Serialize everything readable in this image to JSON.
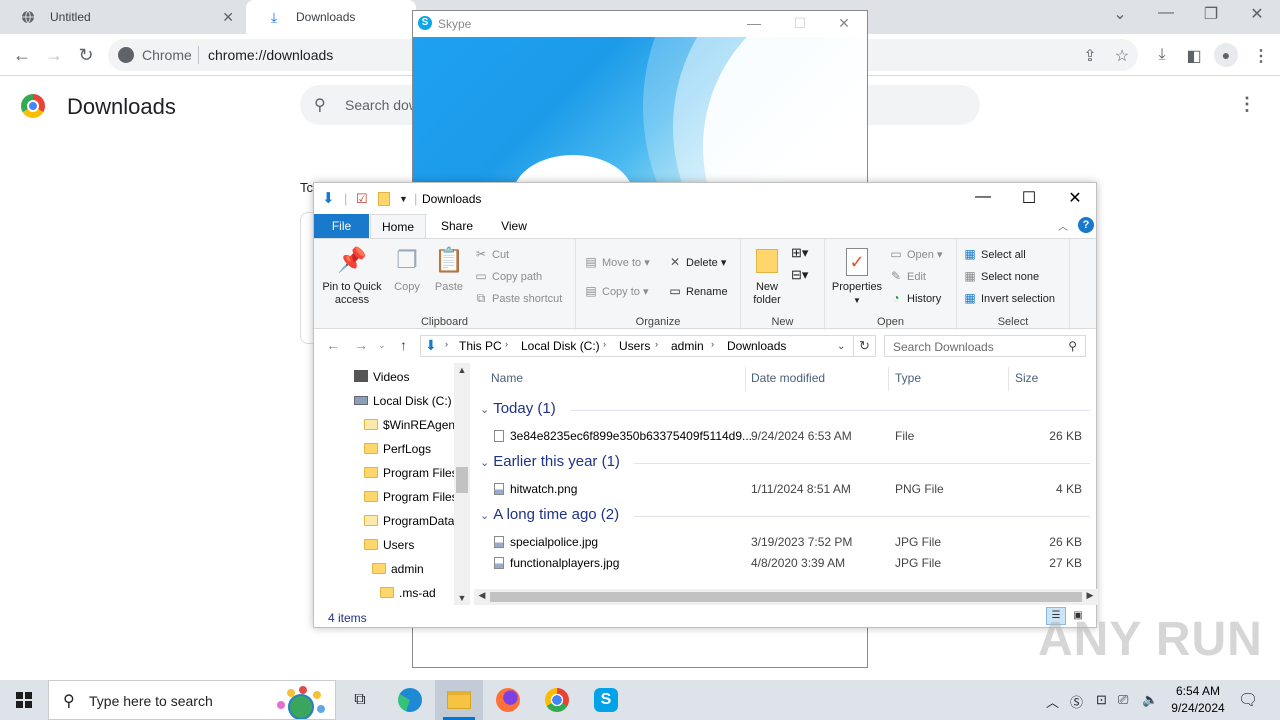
{
  "chrome": {
    "tabs": [
      {
        "title": "Untitled",
        "close": "✕"
      },
      {
        "title": "Downloads",
        "close": "✕"
      }
    ],
    "omnibox": {
      "site_chip": "Chrome",
      "url": "chrome://downloads"
    },
    "page_title": "Downloads",
    "search_placeholder": "Search downloads",
    "partial_label": "Tc"
  },
  "skype": {
    "title": "Skype"
  },
  "explorer": {
    "title": "Downloads",
    "ribbon_tabs": [
      "File",
      "Home",
      "Share",
      "View"
    ],
    "clipboard": {
      "label": "Clipboard",
      "pin": "Pin to Quick access",
      "copy": "Copy",
      "paste": "Paste",
      "cut": "Cut",
      "copy_path": "Copy path",
      "paste_shortcut": "Paste shortcut"
    },
    "organize": {
      "label": "Organize",
      "move_to": "Move to",
      "copy_to": "Copy to",
      "delete": "Delete",
      "rename": "Rename"
    },
    "new": {
      "label": "New",
      "new_folder": "New folder"
    },
    "open": {
      "label": "Open",
      "properties": "Properties",
      "open": "Open",
      "edit": "Edit",
      "history": "History"
    },
    "select": {
      "label": "Select",
      "select_all": "Select all",
      "select_none": "Select none",
      "invert": "Invert selection"
    },
    "breadcrumb": [
      "This PC",
      "Local Disk (C:)",
      "Users",
      "admin",
      "Downloads"
    ],
    "search_placeholder": "Search Downloads",
    "nav_tree": [
      "Videos",
      "Local Disk (C:)",
      "$WinREAgent",
      "PerfLogs",
      "Program Files",
      "Program Files",
      "ProgramData",
      "Users",
      "admin",
      ".ms-ad"
    ],
    "columns": [
      "Name",
      "Date modified",
      "Type",
      "Size"
    ],
    "groups": [
      {
        "label": "Today (1)",
        "files": [
          {
            "name": "3e84e8235ec6f899e350b63375409f5114d9...",
            "date": "9/24/2024 6:53 AM",
            "type": "File",
            "size": "26 KB",
            "icon": "doc-icon"
          }
        ]
      },
      {
        "label": "Earlier this year (1)",
        "files": [
          {
            "name": "hitwatch.png",
            "date": "1/11/2024 8:51 AM",
            "type": "PNG File",
            "size": "4 KB",
            "icon": "image-icon"
          }
        ]
      },
      {
        "label": "A long time ago (2)",
        "files": [
          {
            "name": "specialpolice.jpg",
            "date": "3/19/2023 7:52 PM",
            "type": "JPG File",
            "size": "26 KB",
            "icon": "image-icon"
          },
          {
            "name": "functionalplayers.jpg",
            "date": "4/8/2020 3:39 AM",
            "type": "JPG File",
            "size": "27 KB",
            "icon": "image-icon"
          }
        ]
      }
    ],
    "status": "4 items"
  },
  "watermark": "ANY RUN",
  "taskbar": {
    "search_placeholder": "Type here to search",
    "time": "6:54 AM",
    "date": "9/24/2024"
  },
  "colors": {
    "explorer_file_tab": "#1979ca",
    "skype_blue": "#1ea1f2",
    "taskbar": "#dee3ea",
    "chrome_tabstrip": "#dee1e6"
  }
}
